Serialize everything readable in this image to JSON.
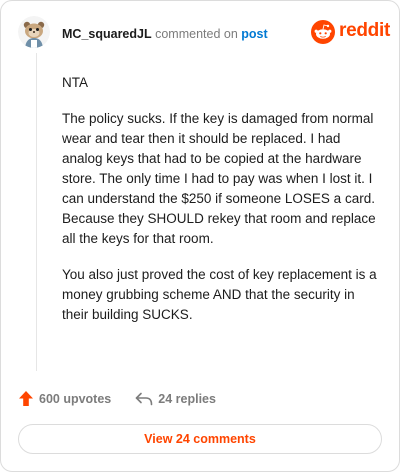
{
  "header": {
    "username": "MC_squaredJL",
    "commented_on": "commented on",
    "post_link": "post",
    "brand": "reddit"
  },
  "comment": {
    "paragraphs": [
      "NTA",
      "The policy sucks. If the key is damaged from normal wear and tear then it should be replaced. I had analog keys that had to be copied at the hardware store. The only time I had to pay was when I lost it. I can understand the $250 if someone LOSES a card. Because they SHOULD rekey that room and replace all the keys for that room.",
      "You also just proved the cost of key replacement is a money grubbing scheme AND that the security in their building SUCKS."
    ]
  },
  "actions": {
    "upvotes": "600 upvotes",
    "replies": "24 replies"
  },
  "footer": {
    "view_comments": "View 24 comments"
  },
  "colors": {
    "brand": "#ff4500",
    "link": "#0079d3",
    "muted": "#7c7c7c"
  },
  "icons": {
    "avatar": "snoo-avatar",
    "logo": "reddit-snoo-icon",
    "upvote": "upvote-arrow-icon",
    "reply": "reply-arrow-icon"
  }
}
